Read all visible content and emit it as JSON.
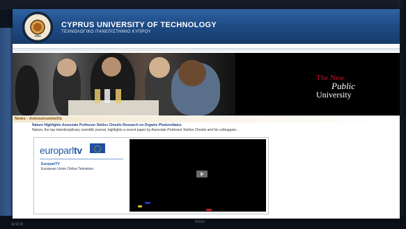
{
  "header": {
    "title": "CYPRUS UNIVERSITY OF TECHNOLOGY",
    "subtitle": "ΤΕΧΝΟΛΟΓΙΚΟ ΠΑΝΕΠΙΣΤΗΜΙΟ ΚΥΠΡΟΥ",
    "logo_year": "2004"
  },
  "banner": {
    "slogan_the": "The New",
    "slogan_public": "Public",
    "slogan_university": "University"
  },
  "news": {
    "label": "News - Announcements",
    "headline": "Nature Highlights Associate Professor Stelios Choulis Research on Organic Photovoltaics",
    "text": "Nature, the top interdisciplinary scientific journal, highlights a recent paper by Associate Professor Stelios Choulis and his colleagues..."
  },
  "video": {
    "brand": "europarl",
    "brand_tv": "tv",
    "channel_name": "EuroparlTV",
    "channel_desc": "European Union Online Television"
  },
  "footer": {
    "left_glyph": "▤ ▤ ▥",
    "center_glyph": "cisco"
  },
  "colors": {
    "header_blue": "#1f4c86",
    "slogan_red": "#c8102e",
    "europarl_blue": "#1f5aa6"
  }
}
